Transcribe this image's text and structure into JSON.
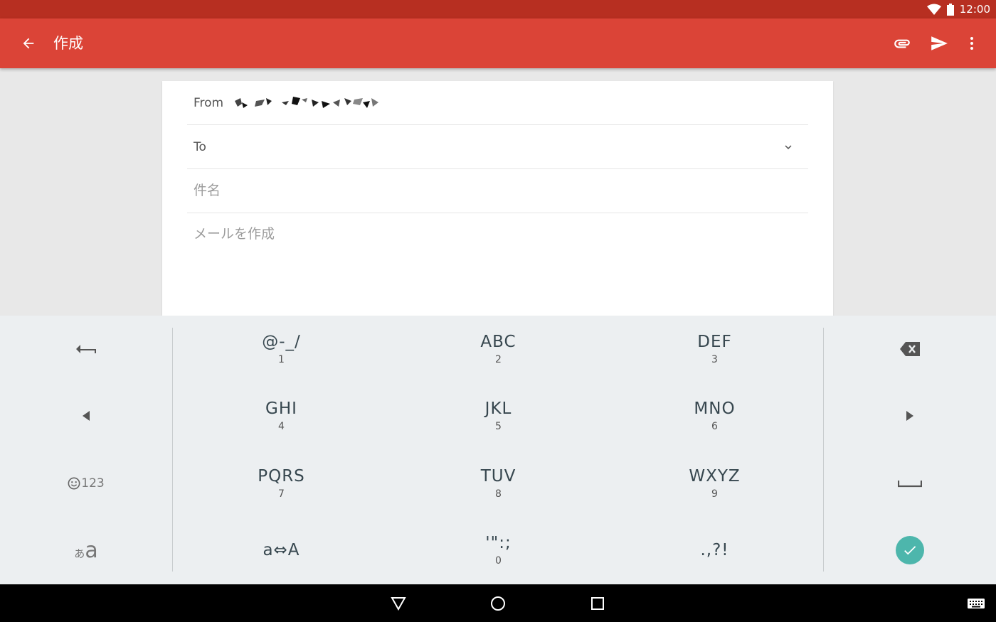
{
  "status_bar": {
    "time": "12:00",
    "icons": [
      "wifi-icon",
      "battery-icon"
    ]
  },
  "app_bar": {
    "title": "作成",
    "back_icon": "arrow-left-icon",
    "actions": [
      "paperclip-icon",
      "send-icon",
      "more-vert-icon"
    ]
  },
  "compose": {
    "from_label": "From",
    "to_label": "To",
    "to_value": "",
    "subject_placeholder": "件名",
    "subject_value": "",
    "body_placeholder": "メールを作成",
    "body_value": ""
  },
  "keyboard": {
    "left_keys": [
      "undo-arrow-icon",
      "cursor-left-icon",
      "emoji-123",
      "kana-alpha-toggle"
    ],
    "emoji_label": "123",
    "lang_small": "あ",
    "lang_big": "a",
    "rows": [
      [
        {
          "main": "@-_/",
          "sub": "1"
        },
        {
          "main": "ABC",
          "sub": "2"
        },
        {
          "main": "DEF",
          "sub": "3"
        }
      ],
      [
        {
          "main": "GHI",
          "sub": "4"
        },
        {
          "main": "JKL",
          "sub": "5"
        },
        {
          "main": "MNO",
          "sub": "6"
        }
      ],
      [
        {
          "main": "PQRS",
          "sub": "7"
        },
        {
          "main": "TUV",
          "sub": "8"
        },
        {
          "main": "WXYZ",
          "sub": "9"
        }
      ],
      [
        {
          "main": "a⇔A",
          "sub": ""
        },
        {
          "main": "'\":;",
          "sub": "0"
        },
        {
          "main": ".,?!",
          "sub": ""
        }
      ]
    ],
    "right_keys": [
      "backspace-icon",
      "cursor-right-icon",
      "space-icon",
      "check-icon"
    ],
    "accent": "#4db6ac"
  },
  "nav_bar": {
    "icons": [
      "nav-back-icon",
      "nav-home-icon",
      "nav-recents-icon",
      "keyboard-icon"
    ]
  },
  "colors": {
    "status_bar": "#b72f21",
    "app_bar": "#db4437",
    "keyboard_bg": "#eceff1"
  }
}
